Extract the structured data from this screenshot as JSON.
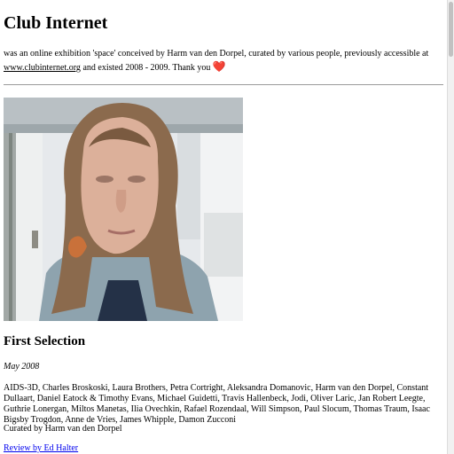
{
  "page": {
    "title": "Club Internet",
    "intro": {
      "text_before": "was an online exhibition 'space' conceived by Harm van den Dorpel, curated by various people, previously accessible at ",
      "link_text": "www.clubinternet.org",
      "text_after": " and existed 2008 - 2009. Thank you ",
      "heart": "❤️"
    }
  },
  "selection": {
    "title": "First Selection",
    "date": "May 2008",
    "artists": "AIDS-3D, Charles Broskoski, Laura Brothers, Petra Cortright, Aleksandra Domanovic, Harm van den Dorpel, Constant Dullaart, Daniel Eatock & Timothy Evans, Michael Guidetti, Travis Hallenbeck, Jodi, Oliver Laric, Jan Robert Leegte, Guthrie Lonergan, Miltos Manetas, Ilia Ovechkin, Rafael Rozendaal, Will Simpson, Paul Slocum, Thomas Traum, Isaac Bigsby Trogdon, Anne de Vries, James Whipple, Damon Zucconi",
    "curated": "Curated by Harm van den Dorpel",
    "review_link": "Review by Ed Halter"
  },
  "colors": {
    "link": "#0000ee",
    "heart": "#e0241b",
    "separator": "#9a9a9a"
  }
}
